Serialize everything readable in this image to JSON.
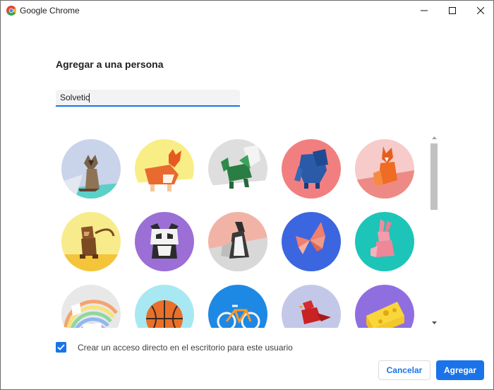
{
  "window": {
    "title": "Google Chrome",
    "brand_colors": [
      "#ea4335",
      "#fbbc04",
      "#34a853",
      "#4285f4"
    ]
  },
  "dialog": {
    "heading": "Agregar a una persona",
    "name_input": {
      "value": "Solvetic",
      "placeholder": ""
    },
    "avatars": [
      {
        "name": "cat",
        "background": "#c9d3ea"
      },
      {
        "name": "corgi",
        "background": "#f9ee86"
      },
      {
        "name": "dragon",
        "background": "#dedede"
      },
      {
        "name": "elephant",
        "background": "#f27f7f"
      },
      {
        "name": "fox",
        "background": "#f6cbc9"
      },
      {
        "name": "monkey",
        "background": "#f8eb8c"
      },
      {
        "name": "panda",
        "background": "#9b6fd6"
      },
      {
        "name": "penguin",
        "background": "#f1b3a6"
      },
      {
        "name": "butterfly",
        "background": "#3c66e0"
      },
      {
        "name": "rabbit",
        "background": "#1cc5b8"
      },
      {
        "name": "unicorn",
        "background": "#e8e8e8"
      },
      {
        "name": "basketball",
        "background": "#a8e8f2"
      },
      {
        "name": "bike",
        "background": "#1e88e5"
      },
      {
        "name": "bird",
        "background": "#c4c8e8"
      },
      {
        "name": "cheese",
        "background": "#8f6fe0"
      }
    ],
    "shortcut_checkbox": {
      "checked": true,
      "label": "Crear un acceso directo en el escritorio para este usuario"
    },
    "cancel_label": "Cancelar",
    "add_label": "Agregar",
    "accent_color": "#1a73e8"
  }
}
